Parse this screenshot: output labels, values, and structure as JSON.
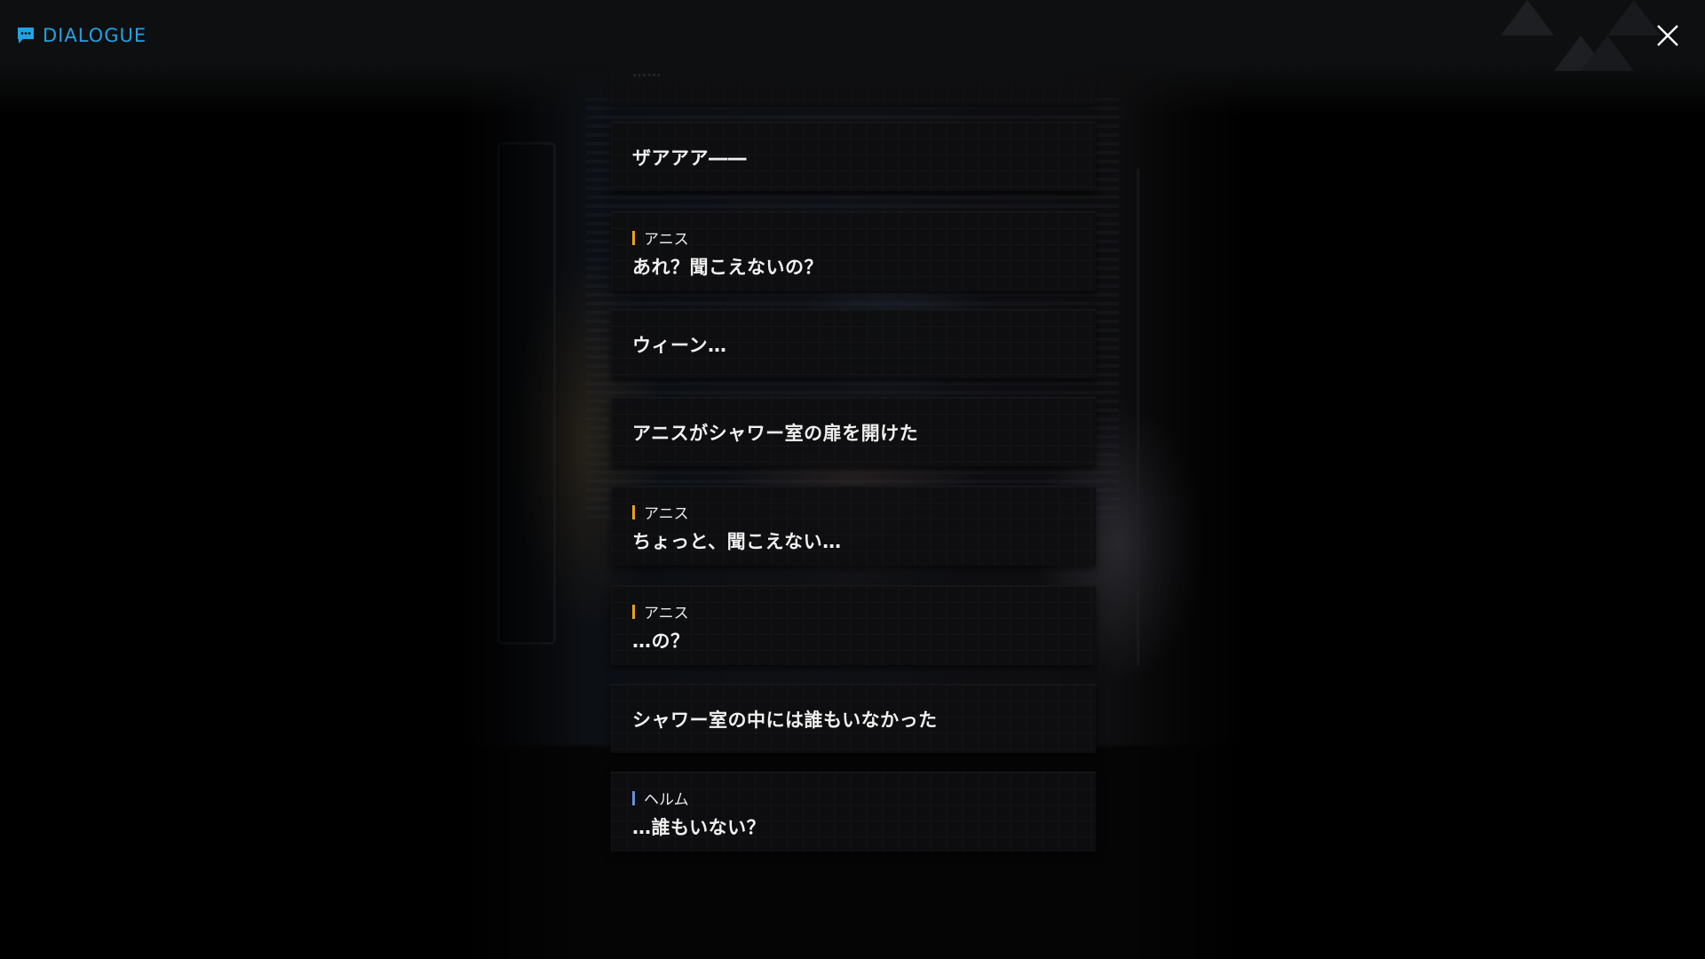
{
  "header": {
    "title": "DIALOGUE",
    "close_icon": "close-icon",
    "chat_icon": "chat-bubble-icon"
  },
  "colors": {
    "accent": "#1fa3e6",
    "anis_marker": "#e8a21f",
    "helm_marker": "#6a8fd8"
  },
  "dialogue": {
    "partial_text": "……",
    "entries": [
      {
        "speaker": "",
        "text": "ザアアア――"
      },
      {
        "speaker": "アニス",
        "text": "あれ？聞こえないの？"
      },
      {
        "speaker": "",
        "text": "ウィーン…"
      },
      {
        "speaker": "",
        "text": "アニスがシャワー室の扉を開けた"
      },
      {
        "speaker": "アニス",
        "text": "ちょっと、聞こえない…"
      },
      {
        "speaker": "アニス",
        "text": "…の？"
      },
      {
        "speaker": "",
        "text": "シャワー室の中には誰もいなかった"
      },
      {
        "speaker": "ヘルム",
        "text": "…誰もいない？"
      }
    ]
  }
}
